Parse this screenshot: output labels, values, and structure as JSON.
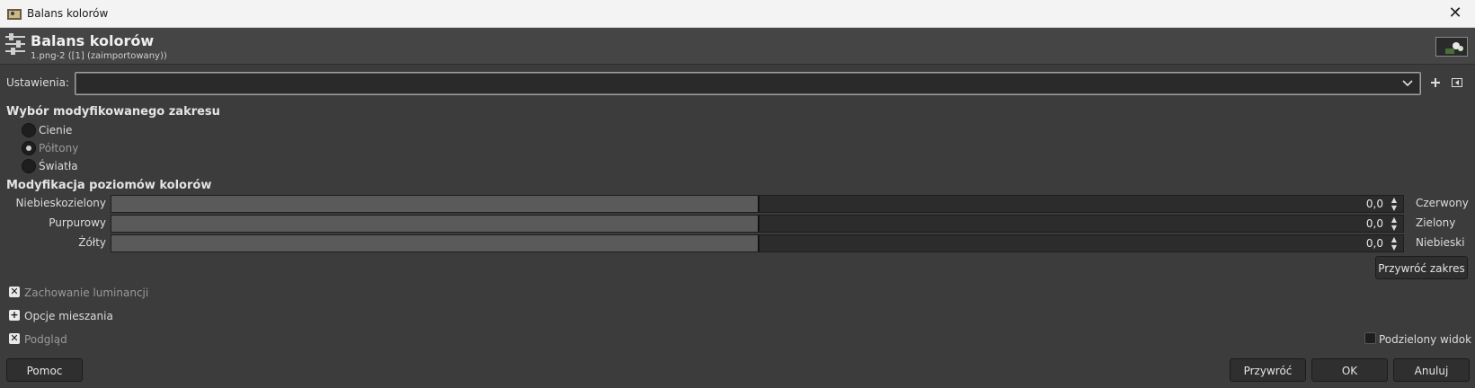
{
  "window": {
    "title": "Balans kolorów"
  },
  "header": {
    "title": "Balans kolorów",
    "subtitle": "1.png-2 ([1] (zaimportowany))"
  },
  "settings": {
    "label": "Ustawienia:",
    "value": ""
  },
  "range": {
    "title": "Wybór modyfikowanego zakresu",
    "options": [
      {
        "label": "Cienie",
        "checked": false
      },
      {
        "label": "Półtony",
        "checked": true
      },
      {
        "label": "Światła",
        "checked": false
      }
    ]
  },
  "levels": {
    "title": "Modyfikacja poziomów kolorów",
    "sliders": [
      {
        "left": "Niebieskozielony",
        "right": "Czerwony",
        "value": "0,0",
        "position": 0.5
      },
      {
        "left": "Purpurowy",
        "right": "Zielony",
        "value": "0,0",
        "position": 0.5
      },
      {
        "left": "Żółty",
        "right": "Niebieski",
        "value": "0,0",
        "position": 0.5
      }
    ],
    "reset_label": "Przywróć zakres"
  },
  "options": {
    "preserve_luminosity": "Zachowanie luminancji",
    "blend_options": "Opcje mieszania",
    "preview": "Podgląd",
    "split_view": "Podzielony widok"
  },
  "buttons": {
    "help": "Pomoc",
    "reset": "Przywróć",
    "ok": "OK",
    "cancel": "Anuluj"
  }
}
